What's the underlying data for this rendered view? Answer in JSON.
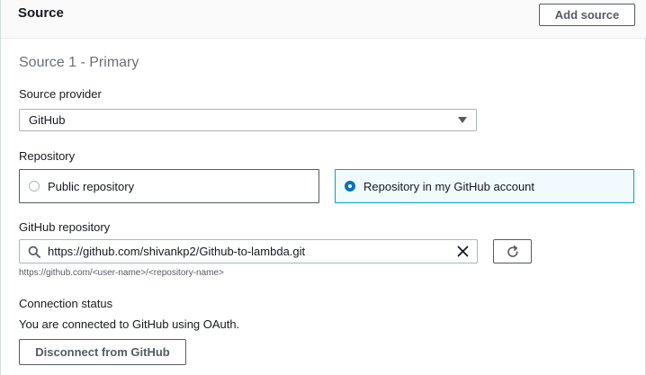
{
  "header": {
    "title": "Source",
    "add_source_label": "Add source"
  },
  "section": {
    "subtitle": "Source 1 - Primary"
  },
  "source_provider": {
    "label": "Source provider",
    "selected": "GitHub"
  },
  "repository": {
    "label": "Repository",
    "options": [
      {
        "label": "Public repository",
        "selected": false
      },
      {
        "label": "Repository in my GitHub account",
        "selected": true
      }
    ]
  },
  "github_repository": {
    "label": "GitHub repository",
    "value": "https://github.com/shivankp2/Github-to-lambda.git",
    "hint": "https://github.com/<user-name>/<repository-name>"
  },
  "connection": {
    "label": "Connection status",
    "status_text": "You are connected to GitHub using OAuth.",
    "disconnect_label": "Disconnect from GitHub"
  },
  "colors": {
    "accent": "#0073bb",
    "selected_border": "#00a1c9",
    "selected_bg": "#f1faff"
  },
  "icons": [
    "search-icon",
    "clear-icon",
    "refresh-icon",
    "chevron-down-icon"
  ]
}
